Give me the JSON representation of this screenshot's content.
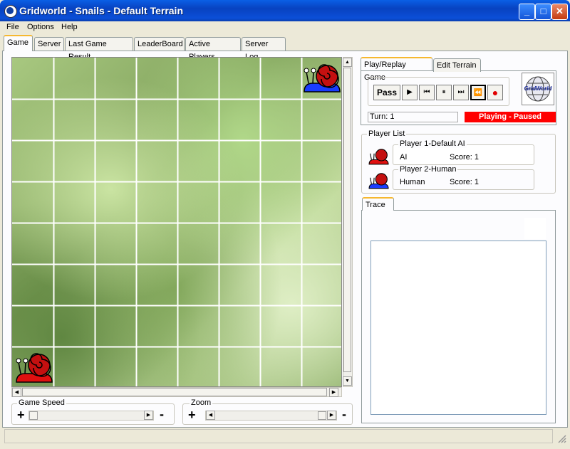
{
  "window": {
    "title": "Gridworld - Snails - Default Terrain",
    "minimize": "_",
    "maximize": "□",
    "close": "✕"
  },
  "menu": {
    "file": "File",
    "options": "Options",
    "help": "Help"
  },
  "tabs": {
    "game": "Game",
    "server": "Server",
    "last_result": "Last Game Result",
    "leaderboard": "LeaderBoard",
    "active_players": "Active Players",
    "server_log": "Server Log"
  },
  "board": {
    "cols": 8,
    "rows": 8,
    "background": "lettuce-photo",
    "snails": [
      {
        "player": 2,
        "color": "blue",
        "col": 7,
        "row": 0
      },
      {
        "player": 1,
        "color": "red",
        "col": 0,
        "row": 7
      }
    ]
  },
  "bottom": {
    "game_speed_label": "Game Speed",
    "zoom_label": "Zoom",
    "plus": "+",
    "minus": "-"
  },
  "right_tabs": {
    "play": "Play/Replay Game",
    "edit": "Edit Terrain"
  },
  "controls": {
    "pass": "Pass",
    "play_icon": "play-icon",
    "first_icon": "skip-first-icon",
    "pause_icon": "pause-icon",
    "last_icon": "skip-last-icon",
    "rewind_icon": "rewind-icon",
    "record_icon": "record-icon"
  },
  "logo": {
    "text": "GridWorld"
  },
  "status": {
    "turn": "Turn: 1",
    "state": "Playing - Paused",
    "state_color": "#ff0000"
  },
  "player_list": {
    "label": "Player List",
    "players": [
      {
        "name": "Player 1-Default AI",
        "type": "AI",
        "score": "Score: 1",
        "snail_color": "red"
      },
      {
        "name": "Player 2-Human",
        "type": "Human",
        "score": "Score: 1",
        "snail_color": "blue"
      }
    ]
  },
  "trace": {
    "tab": "Trace"
  }
}
